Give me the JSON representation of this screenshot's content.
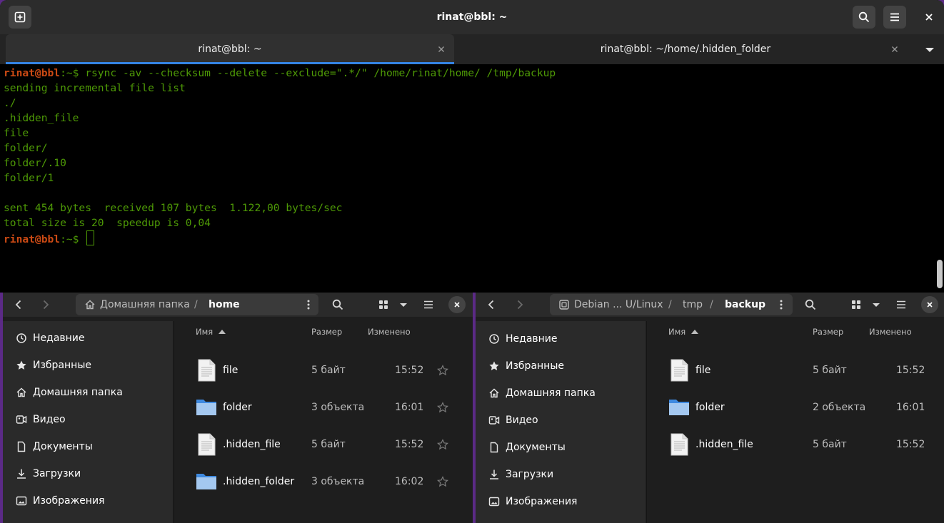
{
  "terminal": {
    "title": "rinat@bbl: ~",
    "tabs": [
      {
        "label": "rinat@bbl: ~",
        "active": true
      },
      {
        "label": "rinat@bbl: ~/home/.hidden_folder",
        "active": false
      }
    ],
    "prompt_user": "rinat@bbl",
    "prompt_rest": ":~$ ",
    "command": "rsync -av --checksum --delete --exclude=\".*/\" /home/rinat/home/ /tmp/backup",
    "output": [
      "sending incremental file list",
      "./",
      ".hidden_file",
      "file",
      "folder/",
      "folder/.10",
      "folder/1",
      "",
      "sent 454 bytes  received 107 bytes  1.122,00 bytes/sec",
      "total size is 20  speedup is 0,04"
    ],
    "colors": {
      "prompt": "#cc4a14",
      "text": "#4e9a06",
      "tab_accent": "#3584e4"
    }
  },
  "fm_left": {
    "breadcrumbs": [
      "Домашняя папка",
      "home"
    ],
    "columns": {
      "name": "Имя",
      "size": "Размер",
      "modified": "Изменено"
    },
    "sidebar": [
      {
        "label": "Недавние",
        "icon": "clock-icon"
      },
      {
        "label": "Избранные",
        "icon": "star-icon"
      },
      {
        "label": "Домашняя папка",
        "icon": "home-icon"
      },
      {
        "label": "Видео",
        "icon": "video-icon"
      },
      {
        "label": "Документы",
        "icon": "document-icon"
      },
      {
        "label": "Загрузки",
        "icon": "download-icon"
      },
      {
        "label": "Изображения",
        "icon": "image-icon"
      }
    ],
    "files": [
      {
        "name": "file",
        "type": "file",
        "size": "5 байт",
        "modified": "15:52"
      },
      {
        "name": "folder",
        "type": "folder",
        "size": "3 объекта",
        "modified": "16:01"
      },
      {
        "name": ".hidden_file",
        "type": "file",
        "size": "5 байт",
        "modified": "15:52"
      },
      {
        "name": ".hidden_folder",
        "type": "folder",
        "size": "3 объекта",
        "modified": "16:02"
      }
    ]
  },
  "fm_right": {
    "breadcrumbs": [
      "Debian ... U/Linux",
      "tmp",
      "backup"
    ],
    "columns": {
      "name": "Имя",
      "size": "Размер",
      "modified": "Изменено"
    },
    "sidebar": [
      {
        "label": "Недавние",
        "icon": "clock-icon"
      },
      {
        "label": "Избранные",
        "icon": "star-icon"
      },
      {
        "label": "Домашняя папка",
        "icon": "home-icon"
      },
      {
        "label": "Видео",
        "icon": "video-icon"
      },
      {
        "label": "Документы",
        "icon": "document-icon"
      },
      {
        "label": "Загрузки",
        "icon": "download-icon"
      },
      {
        "label": "Изображения",
        "icon": "image-icon"
      }
    ],
    "files": [
      {
        "name": "file",
        "type": "file",
        "size": "5 байт",
        "modified": "15:52"
      },
      {
        "name": "folder",
        "type": "folder",
        "size": "2 объекта",
        "modified": "16:01"
      },
      {
        "name": ".hidden_file",
        "type": "file",
        "size": "5 байт",
        "modified": "15:52"
      }
    ]
  }
}
